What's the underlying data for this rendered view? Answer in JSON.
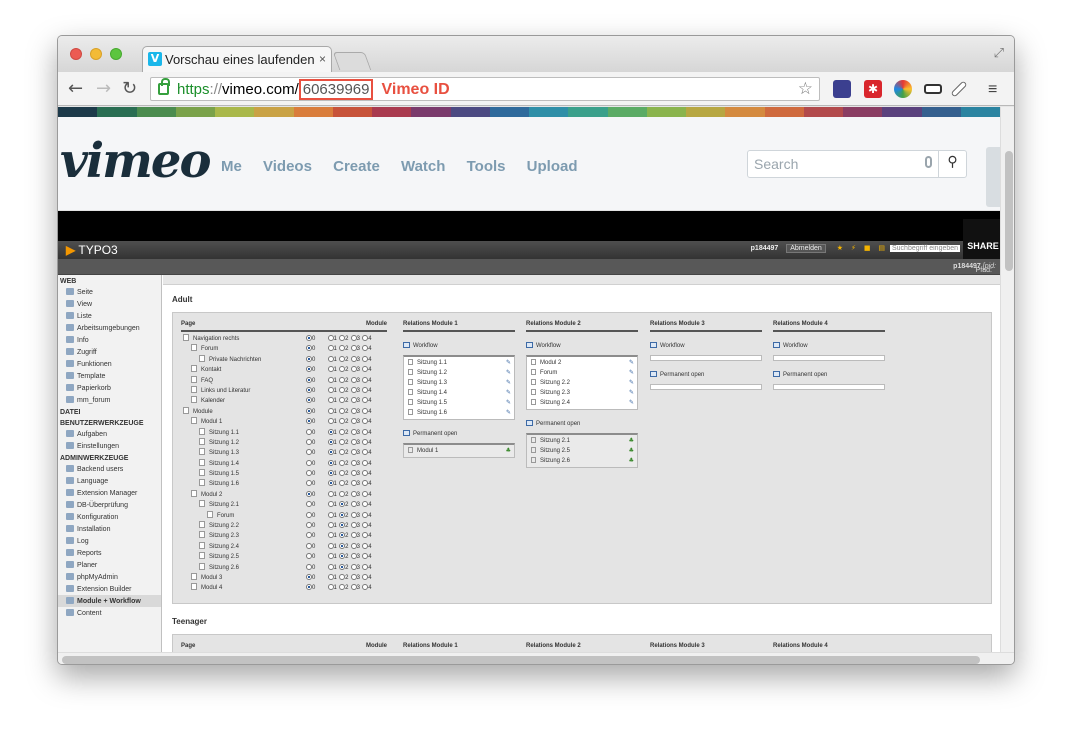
{
  "browser": {
    "tab_title": "Vorschau eines laufenden",
    "tab_close": "×",
    "url_scheme": "https",
    "url_sep": "://",
    "url_host": "vimeo.com/",
    "url_id": "60639969",
    "annotation": "Vimeo ID"
  },
  "vimeo": {
    "logo": "vimeo",
    "nav": [
      "Me",
      "Videos",
      "Create",
      "Watch",
      "Tools",
      "Upload"
    ],
    "search_placeholder": "Search",
    "share": "SHARE",
    "stripe_colors": [
      "#1d3a4a",
      "#2a6e53",
      "#4b8c4f",
      "#7aa24a",
      "#a9b84a",
      "#c9a245",
      "#d97d3c",
      "#c7533a",
      "#a93a4f",
      "#7a3a6c",
      "#4c4a82",
      "#2f6a9c",
      "#2f8fa8",
      "#3aa08b",
      "#5bab65",
      "#8ab44d",
      "#b7a742",
      "#d48a3f",
      "#cf6a3e",
      "#b24a4c",
      "#8a3d63",
      "#5a417d",
      "#35608f",
      "#2b84a1"
    ]
  },
  "typo3": {
    "logo": "TYPO3",
    "user": "p184497",
    "logout": "Abmelden",
    "search_placeholder": "Suchbegriff eingeben",
    "path_label": "Pfad:",
    "path_user": "p184497",
    "path_pid": "[pid:",
    "menu": [
      {
        "group": "Web",
        "items": [
          "Seite",
          "View",
          "Liste",
          "Arbeitsumgebungen",
          "Info",
          "Zugriff",
          "Funktionen",
          "Template",
          "Papierkorb",
          "mm_forum"
        ]
      },
      {
        "group": "Datei",
        "items": []
      },
      {
        "group": "Benutzerwerkzeuge",
        "items": [
          "Aufgaben",
          "Einstellungen"
        ]
      },
      {
        "group": "Adminwerkzeuge",
        "items": [
          "Backend users",
          "Language",
          "Extension Manager",
          "DB-Überprüfung",
          "Konfiguration",
          "Installation",
          "Log",
          "Reports",
          "Planer",
          "phpMyAdmin",
          "Extension Builder",
          "Module + Workflow",
          "Content"
        ]
      }
    ],
    "active_item": "Module + Workflow"
  },
  "module": {
    "section1": "Adult",
    "section2": "Teenager",
    "col_page": "Page",
    "col_module": "Module",
    "rel1": "Relations Module 1",
    "rel2": "Relations Module 2",
    "rel3": "Relations Module 3",
    "rel4": "Relations Module 4",
    "radio_labels": [
      "0",
      "1",
      "2",
      "3",
      "4"
    ],
    "pages": [
      {
        "label": "Navigation rechts",
        "indent": 0,
        "sel": 0
      },
      {
        "label": "Forum",
        "indent": 1,
        "sel": 0
      },
      {
        "label": "Private Nachrichten",
        "indent": 2,
        "sel": 0
      },
      {
        "label": "Kontakt",
        "indent": 1,
        "sel": 0
      },
      {
        "label": "FAQ",
        "indent": 1,
        "sel": 0
      },
      {
        "label": "Links und Literatur",
        "indent": 1,
        "sel": 0
      },
      {
        "label": "Kalender",
        "indent": 1,
        "sel": 0
      },
      {
        "label": "Module",
        "indent": 0,
        "sel": 0
      },
      {
        "label": "Modul 1",
        "indent": 1,
        "sel": 0
      },
      {
        "label": "Sitzung 1.1",
        "indent": 2,
        "sel": 1
      },
      {
        "label": "Sitzung 1.2",
        "indent": 2,
        "sel": 1
      },
      {
        "label": "Sitzung 1.3",
        "indent": 2,
        "sel": 1
      },
      {
        "label": "Sitzung 1.4",
        "indent": 2,
        "sel": 1
      },
      {
        "label": "Sitzung 1.5",
        "indent": 2,
        "sel": 1
      },
      {
        "label": "Sitzung 1.6",
        "indent": 2,
        "sel": 1
      },
      {
        "label": "Modul 2",
        "indent": 1,
        "sel": 0
      },
      {
        "label": "Sitzung 2.1",
        "indent": 2,
        "sel": 2
      },
      {
        "label": "Forum",
        "indent": 3,
        "sel": 2
      },
      {
        "label": "Sitzung 2.2",
        "indent": 2,
        "sel": 2
      },
      {
        "label": "Sitzung 2.3",
        "indent": 2,
        "sel": 2
      },
      {
        "label": "Sitzung 2.4",
        "indent": 2,
        "sel": 2
      },
      {
        "label": "Sitzung 2.5",
        "indent": 2,
        "sel": 2
      },
      {
        "label": "Sitzung 2.6",
        "indent": 2,
        "sel": 2
      },
      {
        "label": "Modul 3",
        "indent": 1,
        "sel": 0
      },
      {
        "label": "Modul 4",
        "indent": 1,
        "sel": 0
      }
    ],
    "workflow": "Workflow",
    "permanent_open": "Permanent open",
    "rel1_workflow": [
      "Sitzung 1.1",
      "Sitzung 1.2",
      "Sitzung 1.3",
      "Sitzung 1.4",
      "Sitzung 1.5",
      "Sitzung 1.6"
    ],
    "rel1_permanent": [
      "Modul 1"
    ],
    "rel2_workflow": [
      "Modul 2",
      "Forum",
      "Sitzung 2.2",
      "Sitzung 2.3",
      "Sitzung 2.4"
    ],
    "rel2_permanent": [
      "Sitzung 2.1",
      "Sitzung 2.5",
      "Sitzung 2.6"
    ]
  }
}
